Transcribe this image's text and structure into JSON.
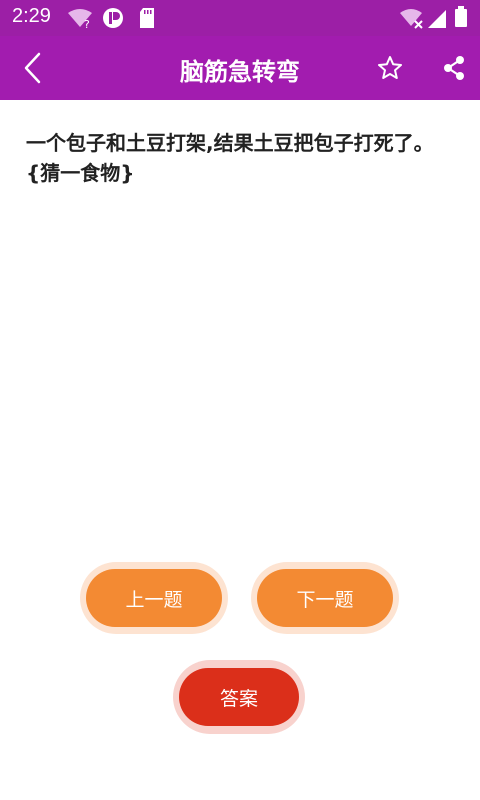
{
  "status_bar": {
    "time": "2:29",
    "wifi_unknown_badge": "?"
  },
  "header": {
    "title": "脑筋急转弯"
  },
  "question": {
    "text": "一个包子和土豆打架,结果土豆把包子打死了。{猜一食物}"
  },
  "buttons": {
    "prev_label": "上一题",
    "next_label": "下一题",
    "answer_label": "答案"
  },
  "colors": {
    "status_bar": "#9c1fa6",
    "app_bar": "#a21caf",
    "nav_button": "#f38a33",
    "nav_button_halo": "#fde3d1",
    "answer_button": "#db2f1a",
    "answer_button_halo": "#f8d2cd"
  }
}
